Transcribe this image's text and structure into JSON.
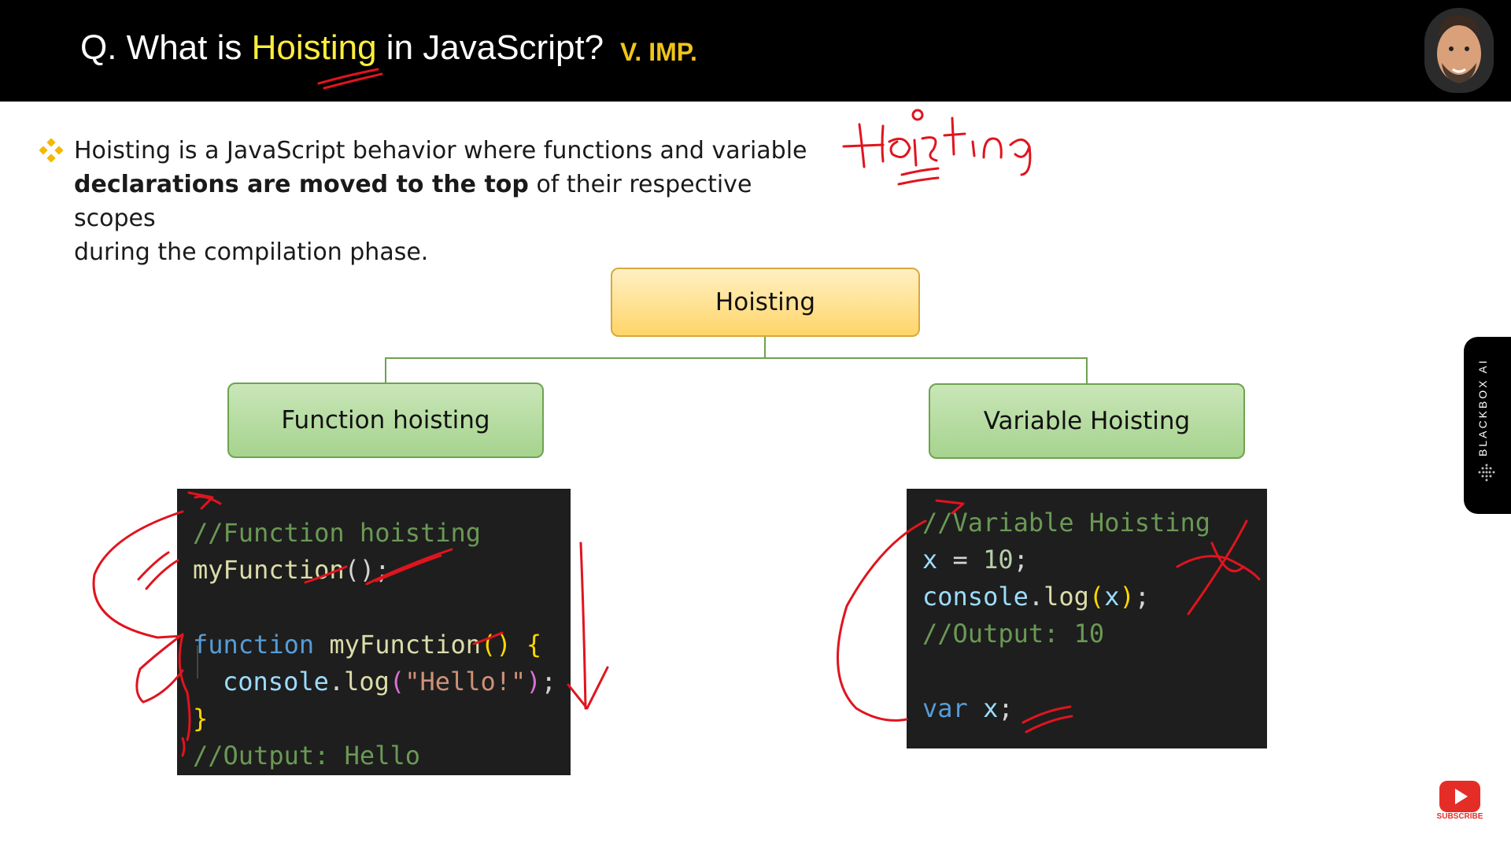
{
  "header": {
    "title_prefix": "Q. What is ",
    "title_highlight": "Hoisting",
    "title_suffix": " in JavaScript?",
    "tag": "V. IMP."
  },
  "bullet": {
    "icon": "diamond-bullet-icon",
    "line1": "Hoisting is a JavaScript behavior where functions and variable",
    "line2_bold": "declarations are moved to the top",
    "line2_rest": " of their respective scopes",
    "line3": "during the compilation phase."
  },
  "diagram": {
    "root": "Hoisting",
    "left": "Function hoisting",
    "right": "Variable Hoisting"
  },
  "code_left": {
    "comment": "//Function hoisting",
    "call_name": "myFunction",
    "call_rest": "();",
    "keyword": "function",
    "decl_name": "myFunction",
    "decl_parens": "()",
    "open_brace": "{",
    "log_obj": "console",
    "log_dot": ".",
    "log_fn": "log",
    "log_open": "(",
    "log_str": "\"Hello!\"",
    "log_close": ")",
    "log_semi": ";",
    "close_brace": "}",
    "output": "//Output: Hello"
  },
  "code_right": {
    "comment": "//Variable Hoisting",
    "assign_var": "x",
    "assign_eq": " = ",
    "assign_num": "10",
    "assign_semi": ";",
    "log_obj": "console",
    "log_dot": ".",
    "log_fn": "log",
    "log_open": "(",
    "log_arg": "x",
    "log_close": ")",
    "log_semi": ";",
    "output": "//Output: 10",
    "keyword": "var",
    "decl_var": "x",
    "decl_semi": ";"
  },
  "side_tab": {
    "label": "BLACKBOX AI"
  },
  "subscribe": {
    "label": "SUBSCRIBE"
  },
  "colors": {
    "header_bg": "#000000",
    "highlight": "#ffee3c",
    "tag": "#f0c419",
    "annotation_ink": "#e0141e",
    "root_box": "#ffd56a",
    "child_box": "#a6d38e",
    "code_bg": "#1e1e1e"
  }
}
